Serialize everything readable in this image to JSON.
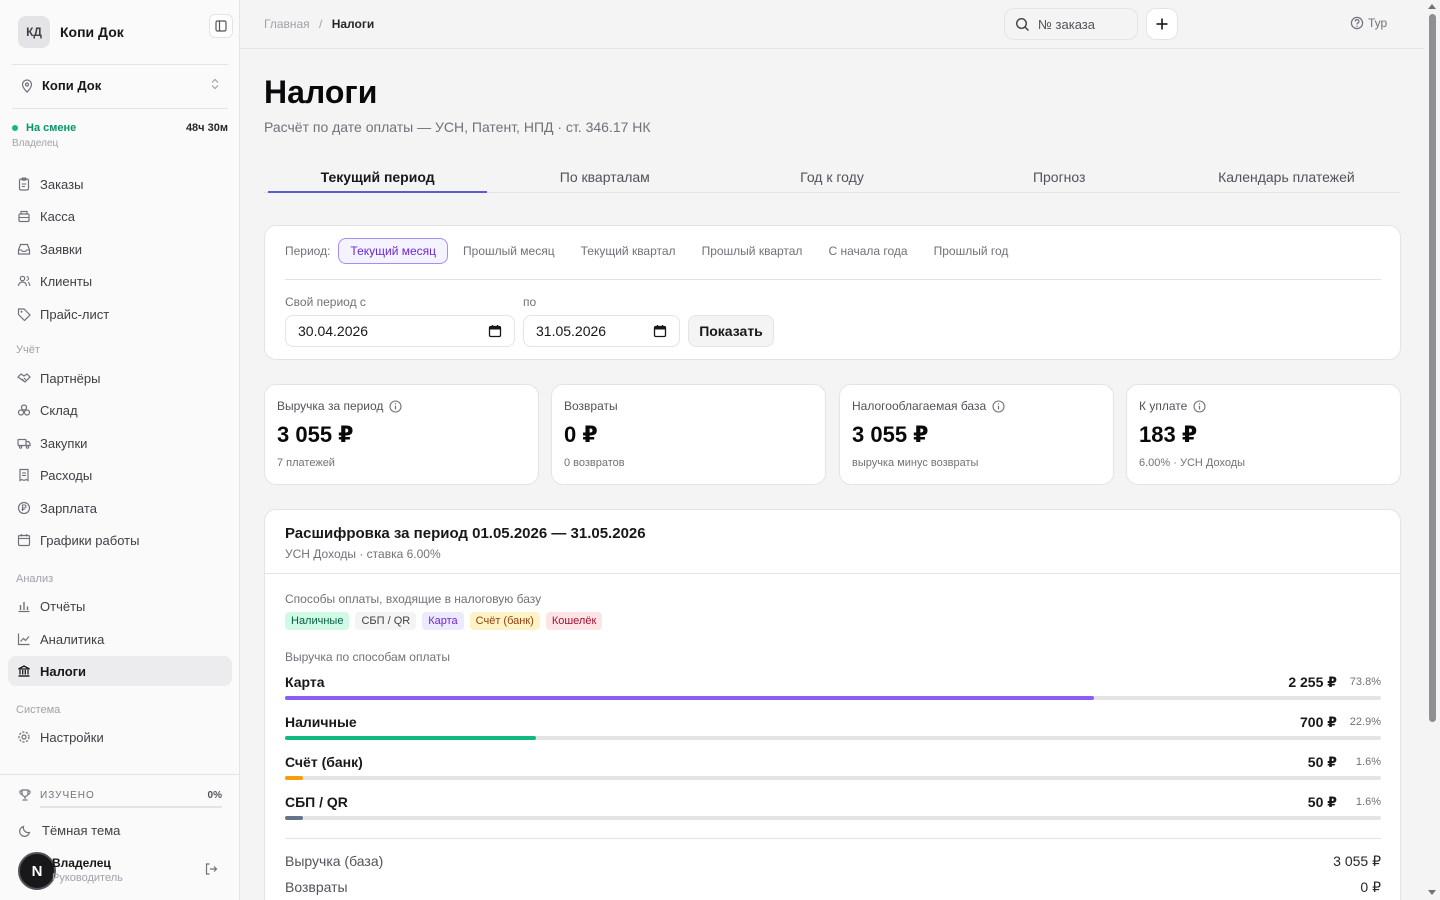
{
  "sidebar": {
    "brand_initials": "КД",
    "brand_name": "Копи Док",
    "location": "Копи Док",
    "shift": {
      "status": "На смене",
      "duration": "48ч 30м",
      "role": "Владелец"
    },
    "nav_main": [
      {
        "label": "Заказы",
        "icon": "clipboard-icon"
      },
      {
        "label": "Касса",
        "icon": "register-icon"
      },
      {
        "label": "Заявки",
        "icon": "inbox-icon"
      },
      {
        "label": "Клиенты",
        "icon": "users-icon"
      },
      {
        "label": "Прайс-лист",
        "icon": "tag-icon"
      }
    ],
    "group_accounting": "Учёт",
    "nav_accounting": [
      {
        "label": "Партнёры",
        "icon": "handshake-icon"
      },
      {
        "label": "Склад",
        "icon": "boxes-icon"
      },
      {
        "label": "Закупки",
        "icon": "truck-icon"
      },
      {
        "label": "Расходы",
        "icon": "receipt-icon"
      },
      {
        "label": "Зарплата",
        "icon": "coin-icon"
      },
      {
        "label": "Графики работы",
        "icon": "calendar-icon"
      }
    ],
    "group_analysis": "Анализ",
    "nav_analysis": [
      {
        "label": "Отчёты",
        "icon": "bar-chart-icon"
      },
      {
        "label": "Аналитика",
        "icon": "line-chart-icon"
      },
      {
        "label": "Налоги",
        "icon": "bank-icon"
      }
    ],
    "group_system": "Система",
    "nav_system": [
      {
        "label": "Настройки",
        "icon": "gear-icon"
      }
    ],
    "learned_label": "ИЗУЧЕНО",
    "learned_pct": "0%",
    "learned_fraction": 0,
    "theme_label": "Тёмная тема",
    "user": {
      "avatar": "N",
      "name": "Владелец",
      "role": "Руководитель"
    }
  },
  "topbar": {
    "breadcrumb_home": "Главная",
    "breadcrumb_sep": "/",
    "breadcrumb_current": "Налоги",
    "search_placeholder": "№ заказа",
    "tour_label": "Тур"
  },
  "page": {
    "title": "Налоги",
    "subtitle": "Расчёт по дате оплаты — УСН, Патент, НПД · ст. 346.17 НК",
    "tabs": [
      "Текущий период",
      "По кварталам",
      "Год к году",
      "Прогноз",
      "Календарь платежей"
    ]
  },
  "period": {
    "label": "Период:",
    "chips": [
      "Текущий месяц",
      "Прошлый месяц",
      "Текущий квартал",
      "Прошлый квартал",
      "С начала года",
      "Прошлый год"
    ],
    "custom_from_label": "Свой период с",
    "custom_to_label": "по",
    "from_value": "30.04.2026",
    "to_value": "31.05.2026",
    "show_button": "Показать"
  },
  "stats": [
    {
      "label": "Выручка за период",
      "value": "3 055 ₽",
      "note": "7 платежей"
    },
    {
      "label": "Возвраты",
      "value": "0 ₽",
      "note": "0 возвратов"
    },
    {
      "label": "Налогооблагаемая база",
      "value": "3 055 ₽",
      "note": "выручка минус возвраты"
    },
    {
      "label": "К уплате",
      "value": "183 ₽",
      "note": "6.00% · УСН Доходы"
    }
  ],
  "breakdown": {
    "title": "Расшифровка за период 01.05.2026 — 31.05.2026",
    "subtitle": "УСН Доходы · ставка 6.00%",
    "methods_label": "Способы оплаты, входящие в налоговую базу",
    "methods": [
      {
        "label": "Наличные",
        "bg": "#d1fae5",
        "fg": "#065f46"
      },
      {
        "label": "СБП / QR",
        "bg": "#f4f4f5",
        "fg": "#3f3f46"
      },
      {
        "label": "Карта",
        "bg": "#ede9fe",
        "fg": "#6d28d9"
      },
      {
        "label": "Счёт (банк)",
        "bg": "#fef3c7",
        "fg": "#92400e"
      },
      {
        "label": "Кошелёк",
        "bg": "#ffe4e6",
        "fg": "#9f1239"
      }
    ],
    "revenue_label": "Выручка по способам оплаты",
    "revenue": [
      {
        "name": "Карта",
        "amount": "2 255 ₽",
        "pct": "73.8%",
        "share": 0.738,
        "color": "#8b5cf6"
      },
      {
        "name": "Наличные",
        "amount": "700 ₽",
        "pct": "22.9%",
        "share": 0.229,
        "color": "#10b981"
      },
      {
        "name": "Счёт (банк)",
        "amount": "50 ₽",
        "pct": "1.6%",
        "share": 0.016,
        "color": "#f59e0b"
      },
      {
        "name": "СБП / QR",
        "amount": "50 ₽",
        "pct": "1.6%",
        "share": 0.016,
        "color": "#64748b"
      }
    ],
    "summary": [
      {
        "label": "Выручка (база)",
        "value": "3 055 ₽"
      },
      {
        "label": "Возвраты",
        "value": "0 ₽"
      }
    ]
  }
}
